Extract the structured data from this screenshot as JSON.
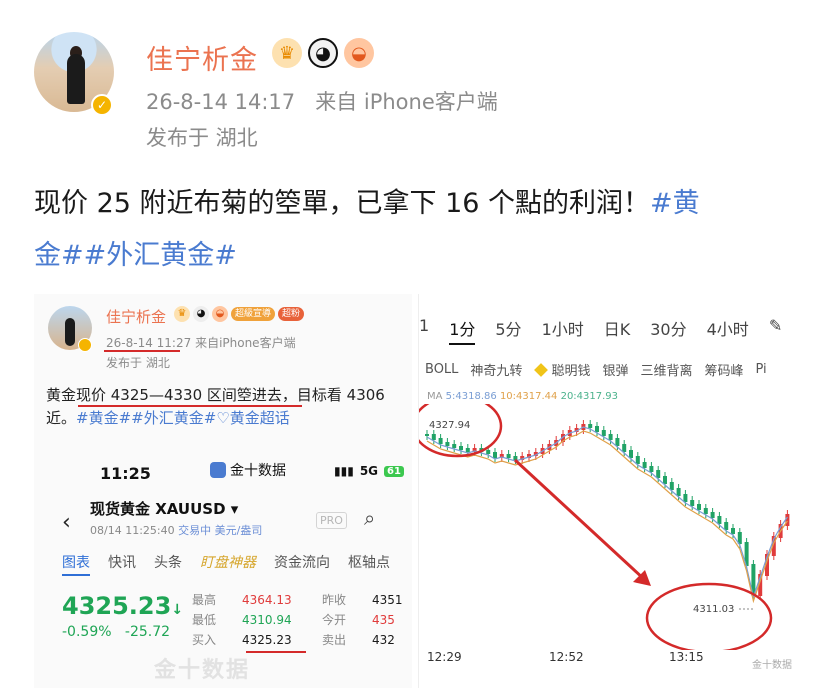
{
  "post": {
    "user_name": "佳宁析金",
    "timestamp": "26-8-14 14:17",
    "source": "来自 iPhone客户端",
    "location": "发布于 湖北",
    "text_line1": "现价 25 附近布菊的箜單，已拿下 16 个點的利润！",
    "tag1": "#黄",
    "tag2": "金##外汇黄金#"
  },
  "screenshot_left": {
    "user_name": "佳宁析金",
    "pill1": "超級宣導",
    "pill2": "超粉",
    "timestamp": "26-8-14 11:27",
    "source": "来自iPhone客户端",
    "location": "发布于 湖北",
    "text": "黄金现价 4325—4330 区间箜进去，目标看 4306",
    "text2_plain": "近。",
    "text2_tags": "#黄金##外汇黄金#",
    "text2_tag3": "♡黄金超话",
    "phone": {
      "time": "11:25",
      "app_name": "金十数据",
      "network": "5G",
      "battery": "61",
      "title": "现货黄金 XAUUSD ▾",
      "subtitle_date": "08/14 11:25:40",
      "subtitle_status": "交易中",
      "subtitle_unit": "美元/盎司",
      "pro": "PRO",
      "tabs": [
        "图表",
        "快讯",
        "头条",
        "盯盘神器",
        "资金流向",
        "枢轴点"
      ],
      "price": "4325.23",
      "change_pct": "-0.59%",
      "change_abs": "-25.72",
      "stats": [
        {
          "label": "最高",
          "value": "4364.13",
          "label2": "昨收",
          "value2": "4351"
        },
        {
          "label": "最低",
          "value": "4310.94",
          "label2": "今开",
          "value2": "435"
        },
        {
          "label": "买入",
          "value": "4325.23",
          "label2": "卖出",
          "value2": "432"
        }
      ]
    },
    "watermark": "金十数据"
  },
  "screenshot_right": {
    "timeframes": [
      "1",
      "1分",
      "5分",
      "1小时",
      "日K",
      "30分",
      "4小时"
    ],
    "indicators": [
      "BOLL",
      "神奇九转",
      "聪明钱",
      "银弹",
      "三维背离",
      "筹码峰",
      "Pi"
    ],
    "ma_line": {
      "ma": "MA",
      "ma5": "5:4318.86",
      "ma10": "10:4317.44",
      "ma20": "20:4317.93"
    },
    "price_high_label": "4327.94",
    "price_low_label": "4311.03",
    "x_labels": [
      "12:29",
      "12:52",
      "13:15"
    ],
    "watermark": "金十数据",
    "colors": {
      "up": "#e03b3b",
      "down": "#21a366",
      "circle": "#d42a2a"
    }
  }
}
